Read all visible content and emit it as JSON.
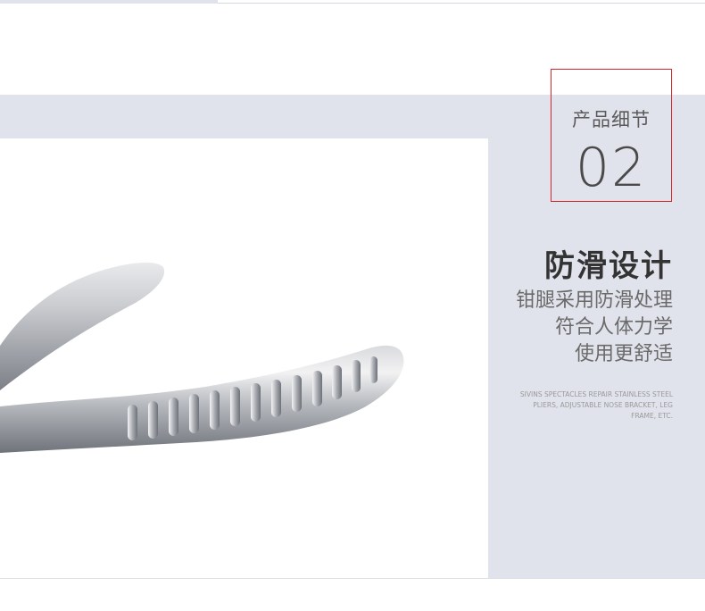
{
  "section": {
    "label": "产品细节",
    "number": "02",
    "frame_color": "#d8262d"
  },
  "feature": {
    "title": "防滑设计",
    "lines": [
      "钳腿采用防滑处理",
      "符合人体力学",
      "使用更舒适"
    ],
    "english": "SIVINS SPECTACLES REPAIR STAINLESS STEEL PLIERS, ADJUSTABLE NOSE BRACKET, LEG FRAME, ETC."
  },
  "colors": {
    "panel": "#e1e3ec",
    "title_text": "#333333",
    "body_text": "#6a6a6a"
  },
  "image": {
    "subject": "stainless-steel-pliers-handle-closeup"
  }
}
